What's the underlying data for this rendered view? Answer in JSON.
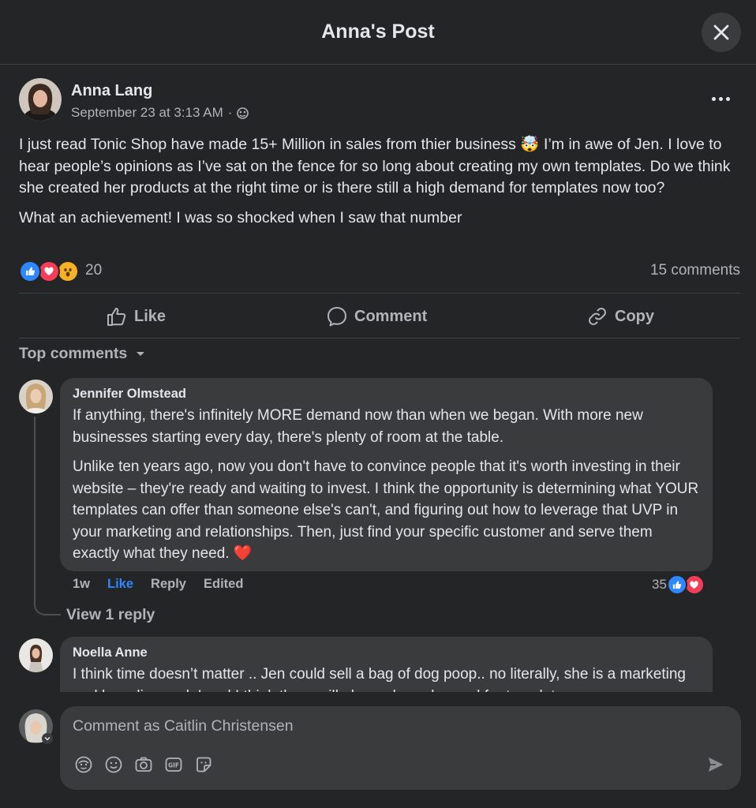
{
  "dialog": {
    "title": "Anna's Post"
  },
  "post": {
    "author": "Anna Lang",
    "timestamp": "September 23 at 3:13 AM",
    "separator": "·",
    "audience_icon": "friends-globe-icon",
    "paragraph_1": "I just read Tonic Shop have made 15+ Million in sales from thier business 🤯 I’m in awe of Jen. I love to hear people’s opinions as I’ve sat on the fence for so long about creating my own templates. Do we think she created her products at the right time or is there still a high demand for templates now too?",
    "paragraph_2": "What an achievement! I was so shocked when I saw that number",
    "reaction_count": "20",
    "comments_count": "15 comments",
    "reaction_icons": [
      "like-reaction-icon",
      "love-reaction-icon",
      "wow-reaction-icon"
    ]
  },
  "actions": {
    "like": "Like",
    "comment": "Comment",
    "copy": "Copy"
  },
  "sort": {
    "label": "Top comments"
  },
  "comments": [
    {
      "author": "Jennifer Olmstead",
      "paragraph_1": "If anything, there's infinitely MORE demand now than when we began. With more new businesses starting every day, there's plenty of room at the table.",
      "paragraph_2": "Unlike ten years ago, now you don't have to convince people that it's worth investing in their website – they're ready and waiting to invest. I think the opportunity is determining what YOUR templates can offer than someone else's can't, and figuring out how to leverage that UVP in your marketing and relationships. Then, just find your specific customer and serve them exactly what they need. ❤️",
      "time": "1w",
      "like": "Like",
      "reply": "Reply",
      "edited": "Edited",
      "reaction_count": "35",
      "view_replies": "View 1 reply"
    },
    {
      "author": "Noella Anne",
      "text": "I think time doesn’t matter .. Jen could sell a bag of dog poop.. no literally, she is a marketing and branding god. I and I think there will always be a demand for templates"
    }
  ],
  "composer": {
    "placeholder": "Comment as Caitlin Christensen",
    "tools": [
      "avatar-sticker-icon",
      "emoji-icon",
      "camera-icon",
      "gif-icon",
      "sticker-icon"
    ]
  }
}
